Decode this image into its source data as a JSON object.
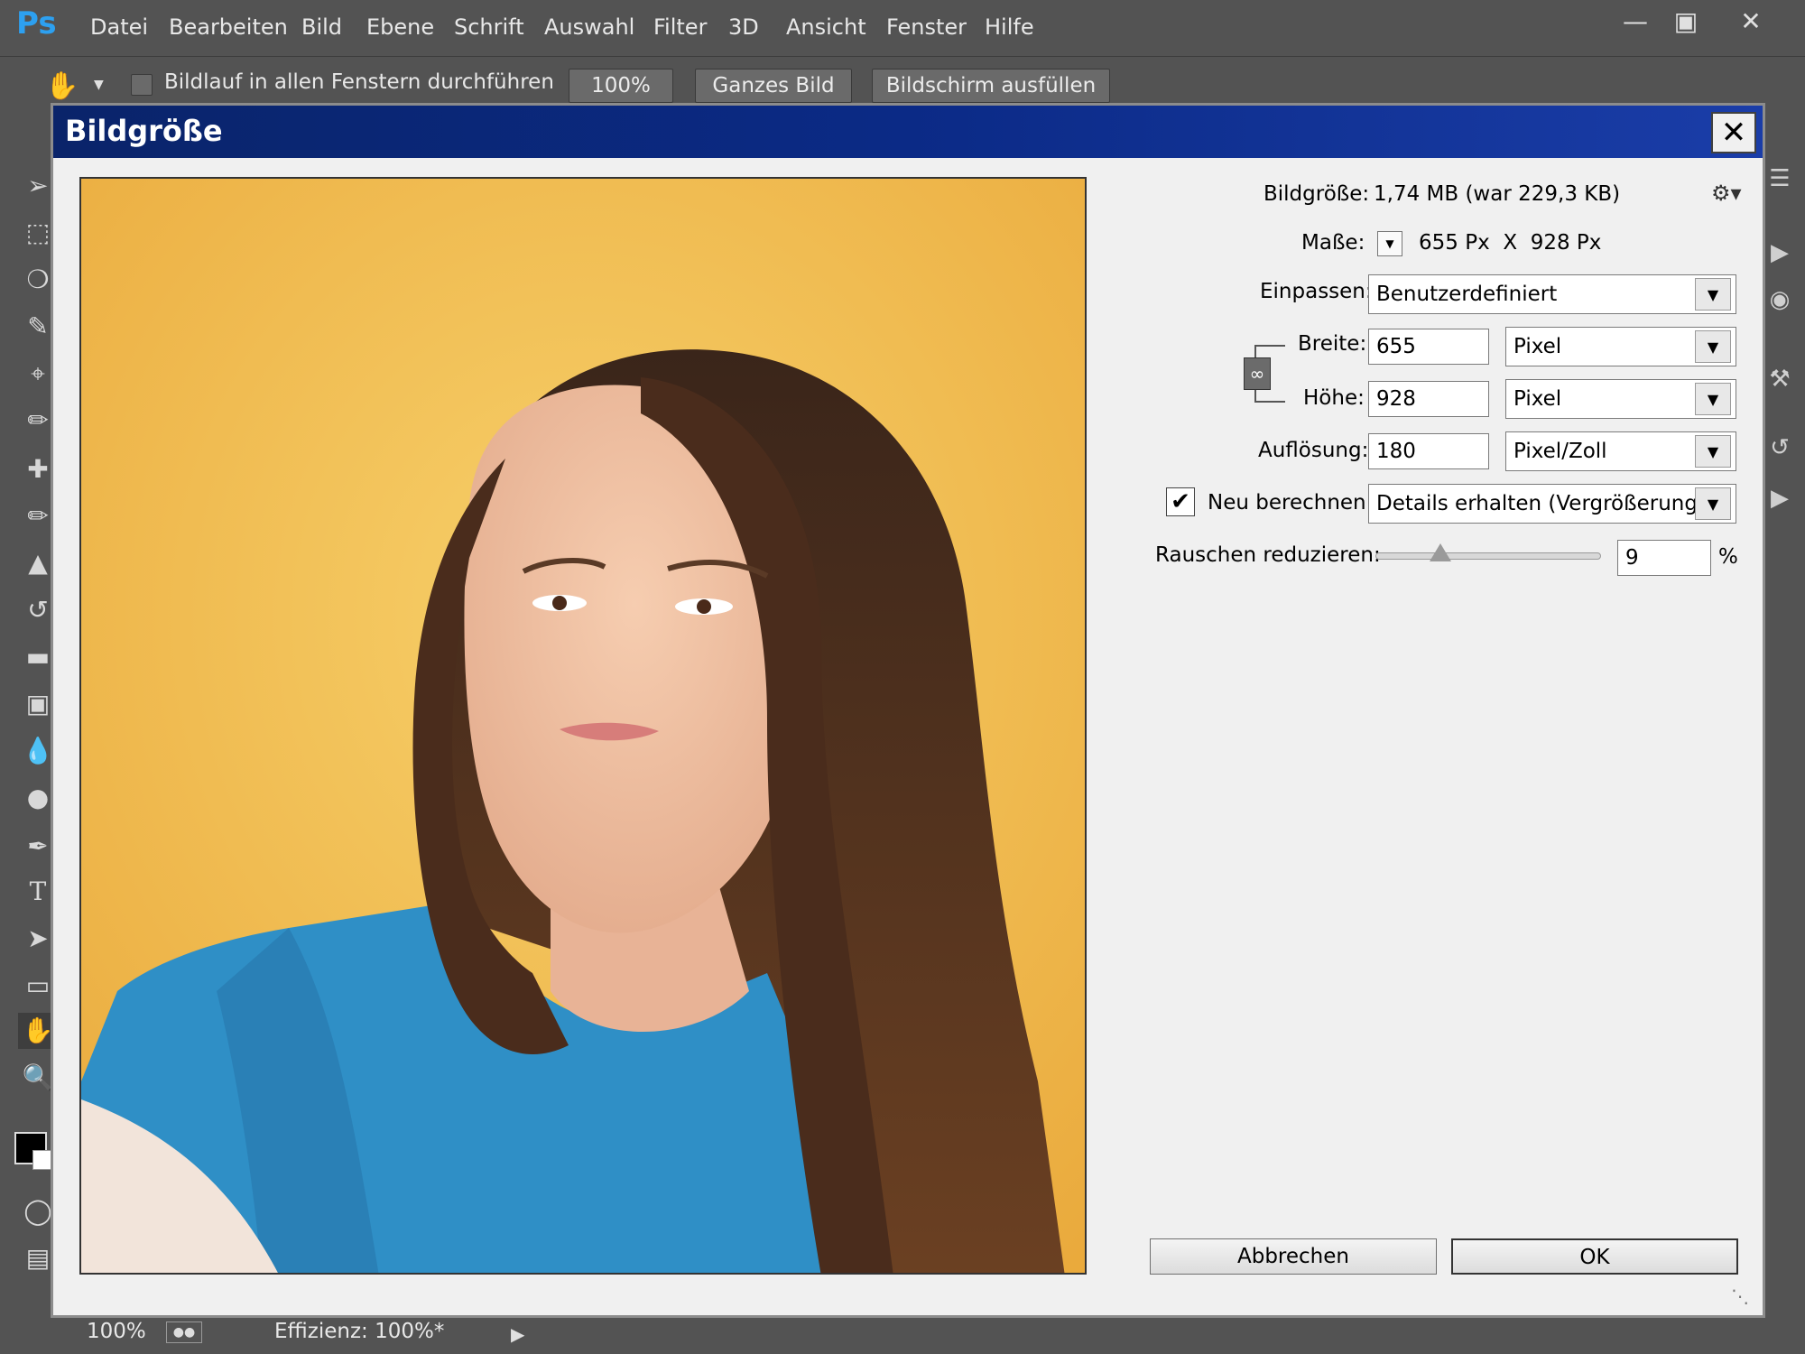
{
  "app": {
    "logo": "Ps"
  },
  "menu": [
    "Datei",
    "Bearbeiten",
    "Bild",
    "Ebene",
    "Schrift",
    "Auswahl",
    "Filter",
    "3D",
    "Ansicht",
    "Fenster",
    "Hilfe"
  ],
  "window_controls": {
    "minimize": "minimize-icon",
    "maximize": "maximize-icon",
    "close": "close-icon"
  },
  "options_bar": {
    "scroll_all_label": "Bildlauf in allen Fenstern durchführen",
    "zoom_100": "100%",
    "fit_screen": "Ganzes Bild",
    "fill_screen": "Bildschirm ausfüllen"
  },
  "dialog": {
    "title": "Bildgröße",
    "image_size_label": "Bildgröße:",
    "image_size_value": "1,74 MB (war 229,3 KB)",
    "dimensions_label": "Maße:",
    "dimensions_value": "655 Px  X  928 Px",
    "fit_label": "Einpassen:",
    "fit_value": "Benutzerdefiniert",
    "width_label": "Breite:",
    "width_value": "655",
    "width_unit": "Pixel",
    "height_label": "Höhe:",
    "height_value": "928",
    "height_unit": "Pixel",
    "resolution_label": "Auflösung:",
    "resolution_value": "180",
    "resolution_unit": "Pixel/Zoll",
    "resample_label": "Neu berechnen:",
    "resample_checked": true,
    "resample_value": "Details erhalten (Vergrößerung)",
    "noise_label": "Rauschen reduzieren:",
    "noise_value": "9",
    "noise_unit": "%",
    "noise_slider_fraction": 0.09,
    "cancel_label": "Abbrechen",
    "ok_label": "OK"
  },
  "status": {
    "zoom": "100%",
    "efficiency": "Effizienz: 100%*"
  }
}
